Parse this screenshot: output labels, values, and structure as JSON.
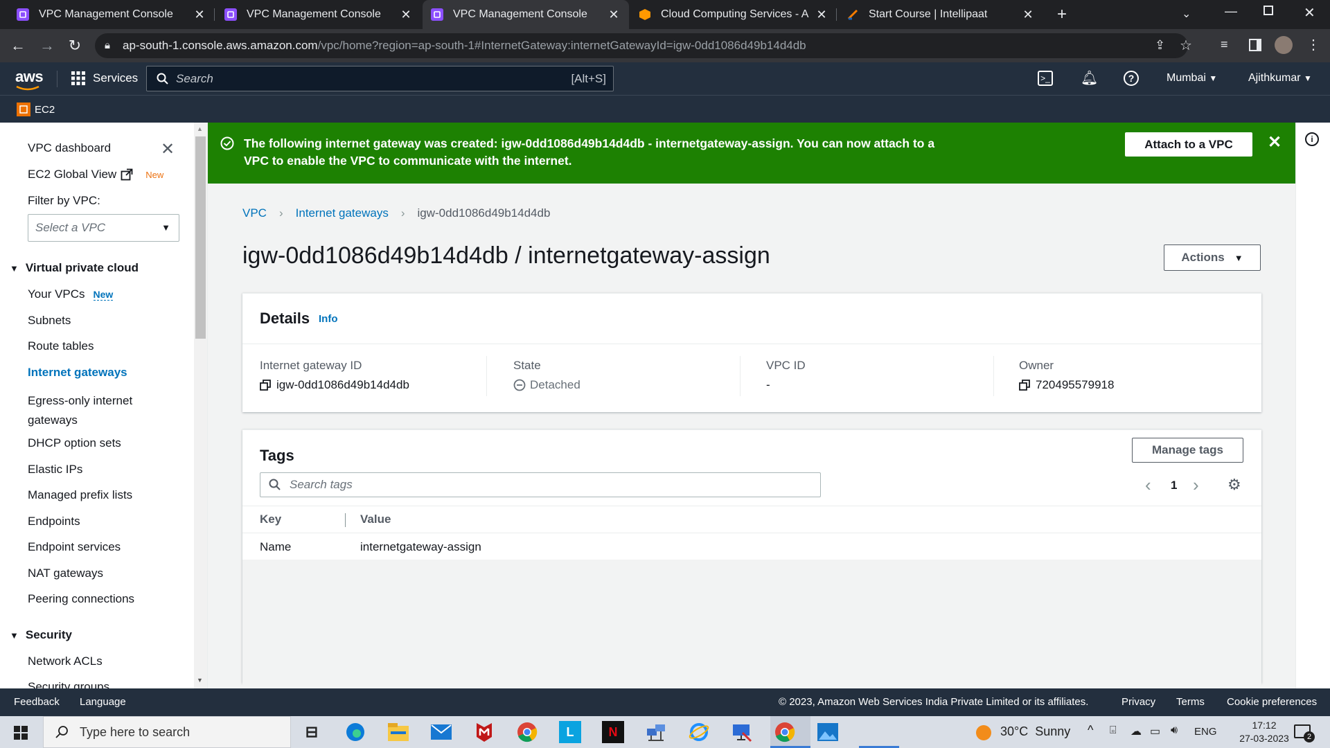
{
  "browser": {
    "tabs": [
      {
        "title": "VPC Management Console",
        "active": false
      },
      {
        "title": "VPC Management Console",
        "active": false
      },
      {
        "title": "VPC Management Console",
        "active": true
      },
      {
        "title": "Cloud Computing Services - Ama",
        "active": false
      },
      {
        "title": "Start Course | Intellipaat",
        "active": false
      }
    ],
    "url_host": "ap-south-1.console.aws.amazon.com",
    "url_path": "/vpc/home?region=ap-south-1#InternetGateway:internetGatewayId=igw-0dd1086d49b14d4db"
  },
  "aws_nav": {
    "logo": "aws",
    "services_label": "Services",
    "search_placeholder": "Search",
    "search_shortcut": "[Alt+S]",
    "region": "Mumbai",
    "user": "Ajithkumar",
    "service_shortcut": "EC2"
  },
  "sidebar": {
    "dashboard": "VPC dashboard",
    "ec2_global_view": "EC2 Global View",
    "new_badge": "New",
    "filter_label": "Filter by VPC:",
    "filter_placeholder": "Select a VPC",
    "section_vpc": "Virtual private cloud",
    "items": [
      "Your VPCs",
      "Subnets",
      "Route tables",
      "Internet gateways",
      "Egress-only internet gateways",
      "DHCP option sets",
      "Elastic IPs",
      "Managed prefix lists",
      "Endpoints",
      "Endpoint services",
      "NAT gateways",
      "Peering connections"
    ],
    "your_vpcs_badge": "New",
    "section_security": "Security",
    "security_items": [
      "Network ACLs",
      "Security groups"
    ]
  },
  "flash": {
    "message": "The following internet gateway was created: igw-0dd1086d49b14d4db - internetgateway-assign. You can now attach to a VPC to enable the VPC to communicate with the internet.",
    "action": "Attach to a VPC"
  },
  "breadcrumb": [
    "VPC",
    "Internet gateways",
    "igw-0dd1086d49b14d4db"
  ],
  "page_title": "igw-0dd1086d49b14d4db / internetgateway-assign",
  "actions_label": "Actions",
  "details": {
    "title": "Details",
    "info": "Info",
    "fields": [
      {
        "label": "Internet gateway ID",
        "value": "igw-0dd1086d49b14d4db"
      },
      {
        "label": "State",
        "value": "Detached"
      },
      {
        "label": "VPC ID",
        "value": "-"
      },
      {
        "label": "Owner",
        "value": "720495579918"
      }
    ]
  },
  "tags": {
    "title": "Tags",
    "manage_label": "Manage tags",
    "search_placeholder": "Search tags",
    "page": "1",
    "columns": [
      "Key",
      "Value"
    ],
    "rows": [
      {
        "key": "Name",
        "value": "internetgateway-assign"
      }
    ]
  },
  "footer": {
    "feedback": "Feedback",
    "language": "Language",
    "copyright": "© 2023, Amazon Web Services India Private Limited or its affiliates.",
    "links": [
      "Privacy",
      "Terms",
      "Cookie preferences"
    ]
  },
  "taskbar": {
    "search_placeholder": "Type here to search",
    "weather": "30°C  Sunny",
    "lang": "ENG",
    "time": "17:12",
    "date": "27-03-2023",
    "notif_count": "2"
  },
  "colors": {
    "aws_nav": "#232f3e",
    "flash_success": "#1d8102",
    "link": "#0073bb",
    "orange": "#ec7211"
  }
}
